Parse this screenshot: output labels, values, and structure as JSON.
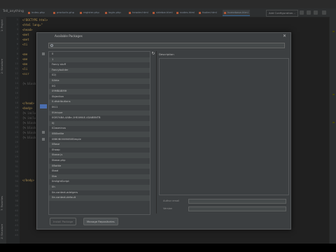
{
  "ide": {
    "project_name": "Tell_anything",
    "tabs": [
      {
        "label": "index.php"
      },
      {
        "label": "products.php"
      },
      {
        "label": "register.php"
      },
      {
        "label": "login.php"
      },
      {
        "label": "header.html"
      },
      {
        "label": "sidebar.html"
      },
      {
        "label": "nodes.html"
      },
      {
        "label": "footer.html"
      },
      {
        "label": "homebase.html",
        "active": true
      }
    ],
    "add_configuration": "Add Configuration...",
    "left_panel_labels": [
      "1: Project",
      "2: Structure",
      "7: Favorites",
      "Z: Structure"
    ],
    "line_numbers": [
      "1",
      "2",
      "3",
      "4",
      "5",
      "6",
      "7",
      "8",
      "9",
      "10",
      "11",
      "12",
      "13",
      "14",
      "15",
      "16",
      "17",
      "18",
      "19",
      "20",
      "21",
      "22",
      "23",
      "24",
      "25",
      "26",
      "27",
      "28",
      "29",
      "30",
      "31",
      "32",
      "33",
      "34",
      "35",
      "36",
      "37",
      "38",
      "39",
      "40",
      "41",
      "42",
      "43",
      "44",
      "45",
      "46",
      "47",
      "48",
      "49",
      "50"
    ],
    "code_lines": [
      "<!DOCTYPE html>",
      "<html lang=\"",
      "  <head>",
      "    <met",
      "    <met",
      "    <ti",
      "",
      "    <me",
      "    <me",
      "    <me",
      "    <li",
      "    <scr",
      "",
      "  {% block",
      "",
      "",
      "",
      "</head>",
      "<body>",
      "  {% inclu",
      "  {% inclu",
      "  {% block",
      "  {% block",
      "  {% block",
      "  {% block",
      "",
      "",
      "</body>"
    ]
  },
  "dialog": {
    "title": "Available Packages",
    "close_label": "✕",
    "search_value": "",
    "refresh_label": "↻",
    "description_label": "Description",
    "packages": [
      "0",
      "1",
      "Fancy stuff",
      "Fancybuilder",
      "02J",
      "0Ahla",
      "0G",
      "09MBABMH",
      "0bjection",
      "0-distributions",
      "0t11",
      "0Unique",
      "0GB7ABA-4ABe-1HEAMAE-4DABBNTB",
      "0J",
      "02asminus",
      "0B0kelite",
      "0BB0B000B0B0Bimple",
      "0Base",
      "0hoop",
      "0base.js",
      "0base-php",
      "0Bottle",
      "0bad",
      "0ba",
      "0mlightScript",
      "0h",
      "0e-context-adelgers",
      "0e-context-default"
    ],
    "author_email_label": "Author email",
    "version_label": "Version",
    "install_button": "Install Package",
    "manage_button": "Manage Repositories"
  },
  "colors": {
    "ide_bg": "#2b2b2b",
    "panel_bg": "#3c3f41",
    "selection": "#4b6eaf",
    "text": "#bbbbbb"
  }
}
